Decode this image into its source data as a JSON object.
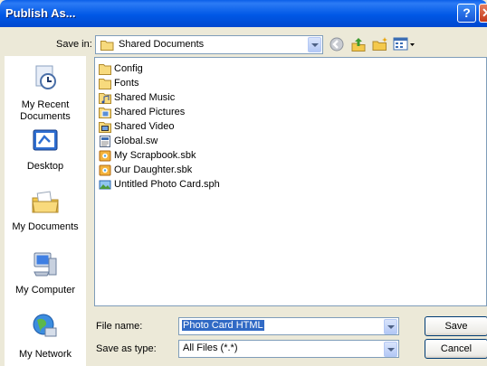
{
  "window": {
    "title": "Publish As..."
  },
  "save_in": {
    "label": "Save in:",
    "value": "Shared Documents"
  },
  "toolbar": {
    "icons": [
      "back-icon",
      "up-folder-icon",
      "new-folder-icon",
      "views-menu-icon"
    ]
  },
  "places": [
    {
      "label_1": "My Recent",
      "label_2": "Documents",
      "icon": "my-recent-documents-icon"
    },
    {
      "label_1": "Desktop",
      "icon": "desktop-icon"
    },
    {
      "label_1": "My Documents",
      "icon": "my-documents-icon"
    },
    {
      "label_1": "My Computer",
      "icon": "my-computer-icon"
    },
    {
      "label_1": "My Network",
      "icon": "my-network-icon"
    }
  ],
  "files": [
    {
      "name": "Config",
      "icon": "folder-icon"
    },
    {
      "name": "Fonts",
      "icon": "folder-icon"
    },
    {
      "name": "Shared Music",
      "icon": "music-folder-icon"
    },
    {
      "name": "Shared Pictures",
      "icon": "pictures-folder-icon"
    },
    {
      "name": "Shared Video",
      "icon": "video-folder-icon"
    },
    {
      "name": "Global.sw",
      "icon": "document-icon"
    },
    {
      "name": "My Scrapbook.sbk",
      "icon": "scrapbook-icon"
    },
    {
      "name": "Our Daughter.sbk",
      "icon": "scrapbook-icon"
    },
    {
      "name": "Untitled Photo Card.sph",
      "icon": "photo-card-icon"
    }
  ],
  "file_name": {
    "label": "File name:",
    "value": "Photo Card HTML"
  },
  "save_as_type": {
    "label": "Save as type:",
    "value": "All Files (*.*)"
  },
  "buttons": {
    "save": "Save",
    "cancel": "Cancel"
  },
  "colors": {
    "title_bar": "#0058E6",
    "dialog_bg": "#ECE9D8",
    "selection": "#316AC5"
  }
}
